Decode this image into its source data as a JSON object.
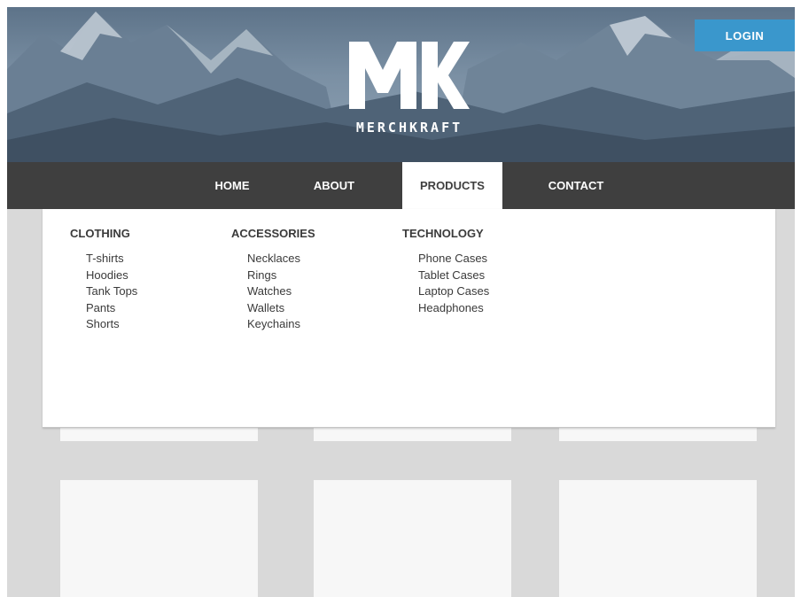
{
  "header": {
    "login_label": "LOGIN",
    "logo_mark": "MK",
    "logo_text": "MERCHKRAFT"
  },
  "nav": {
    "items": [
      {
        "label": "HOME",
        "active": false
      },
      {
        "label": "ABOUT",
        "active": false
      },
      {
        "label": "PRODUCTS",
        "active": true
      },
      {
        "label": "CONTACT",
        "active": false
      }
    ]
  },
  "dropdown": {
    "columns": [
      {
        "title": "CLOTHING",
        "items": [
          "T-shirts",
          "Hoodies",
          "Tank Tops",
          "Pants",
          "Shorts"
        ]
      },
      {
        "title": "ACCESSORIES",
        "items": [
          "Necklaces",
          "Rings",
          "Watches",
          "Wallets",
          "Keychains"
        ]
      },
      {
        "title": "TECHNOLOGY",
        "items": [
          "Phone Cases",
          "Tablet Cases",
          "Laptop Cases",
          "Headphones"
        ]
      }
    ]
  },
  "colors": {
    "accent": "#3a97cc",
    "nav_bg": "#3f3f3f",
    "page_bg": "#d9d9d9",
    "card_bg": "#f7f7f7",
    "text": "#3a3a3a"
  }
}
